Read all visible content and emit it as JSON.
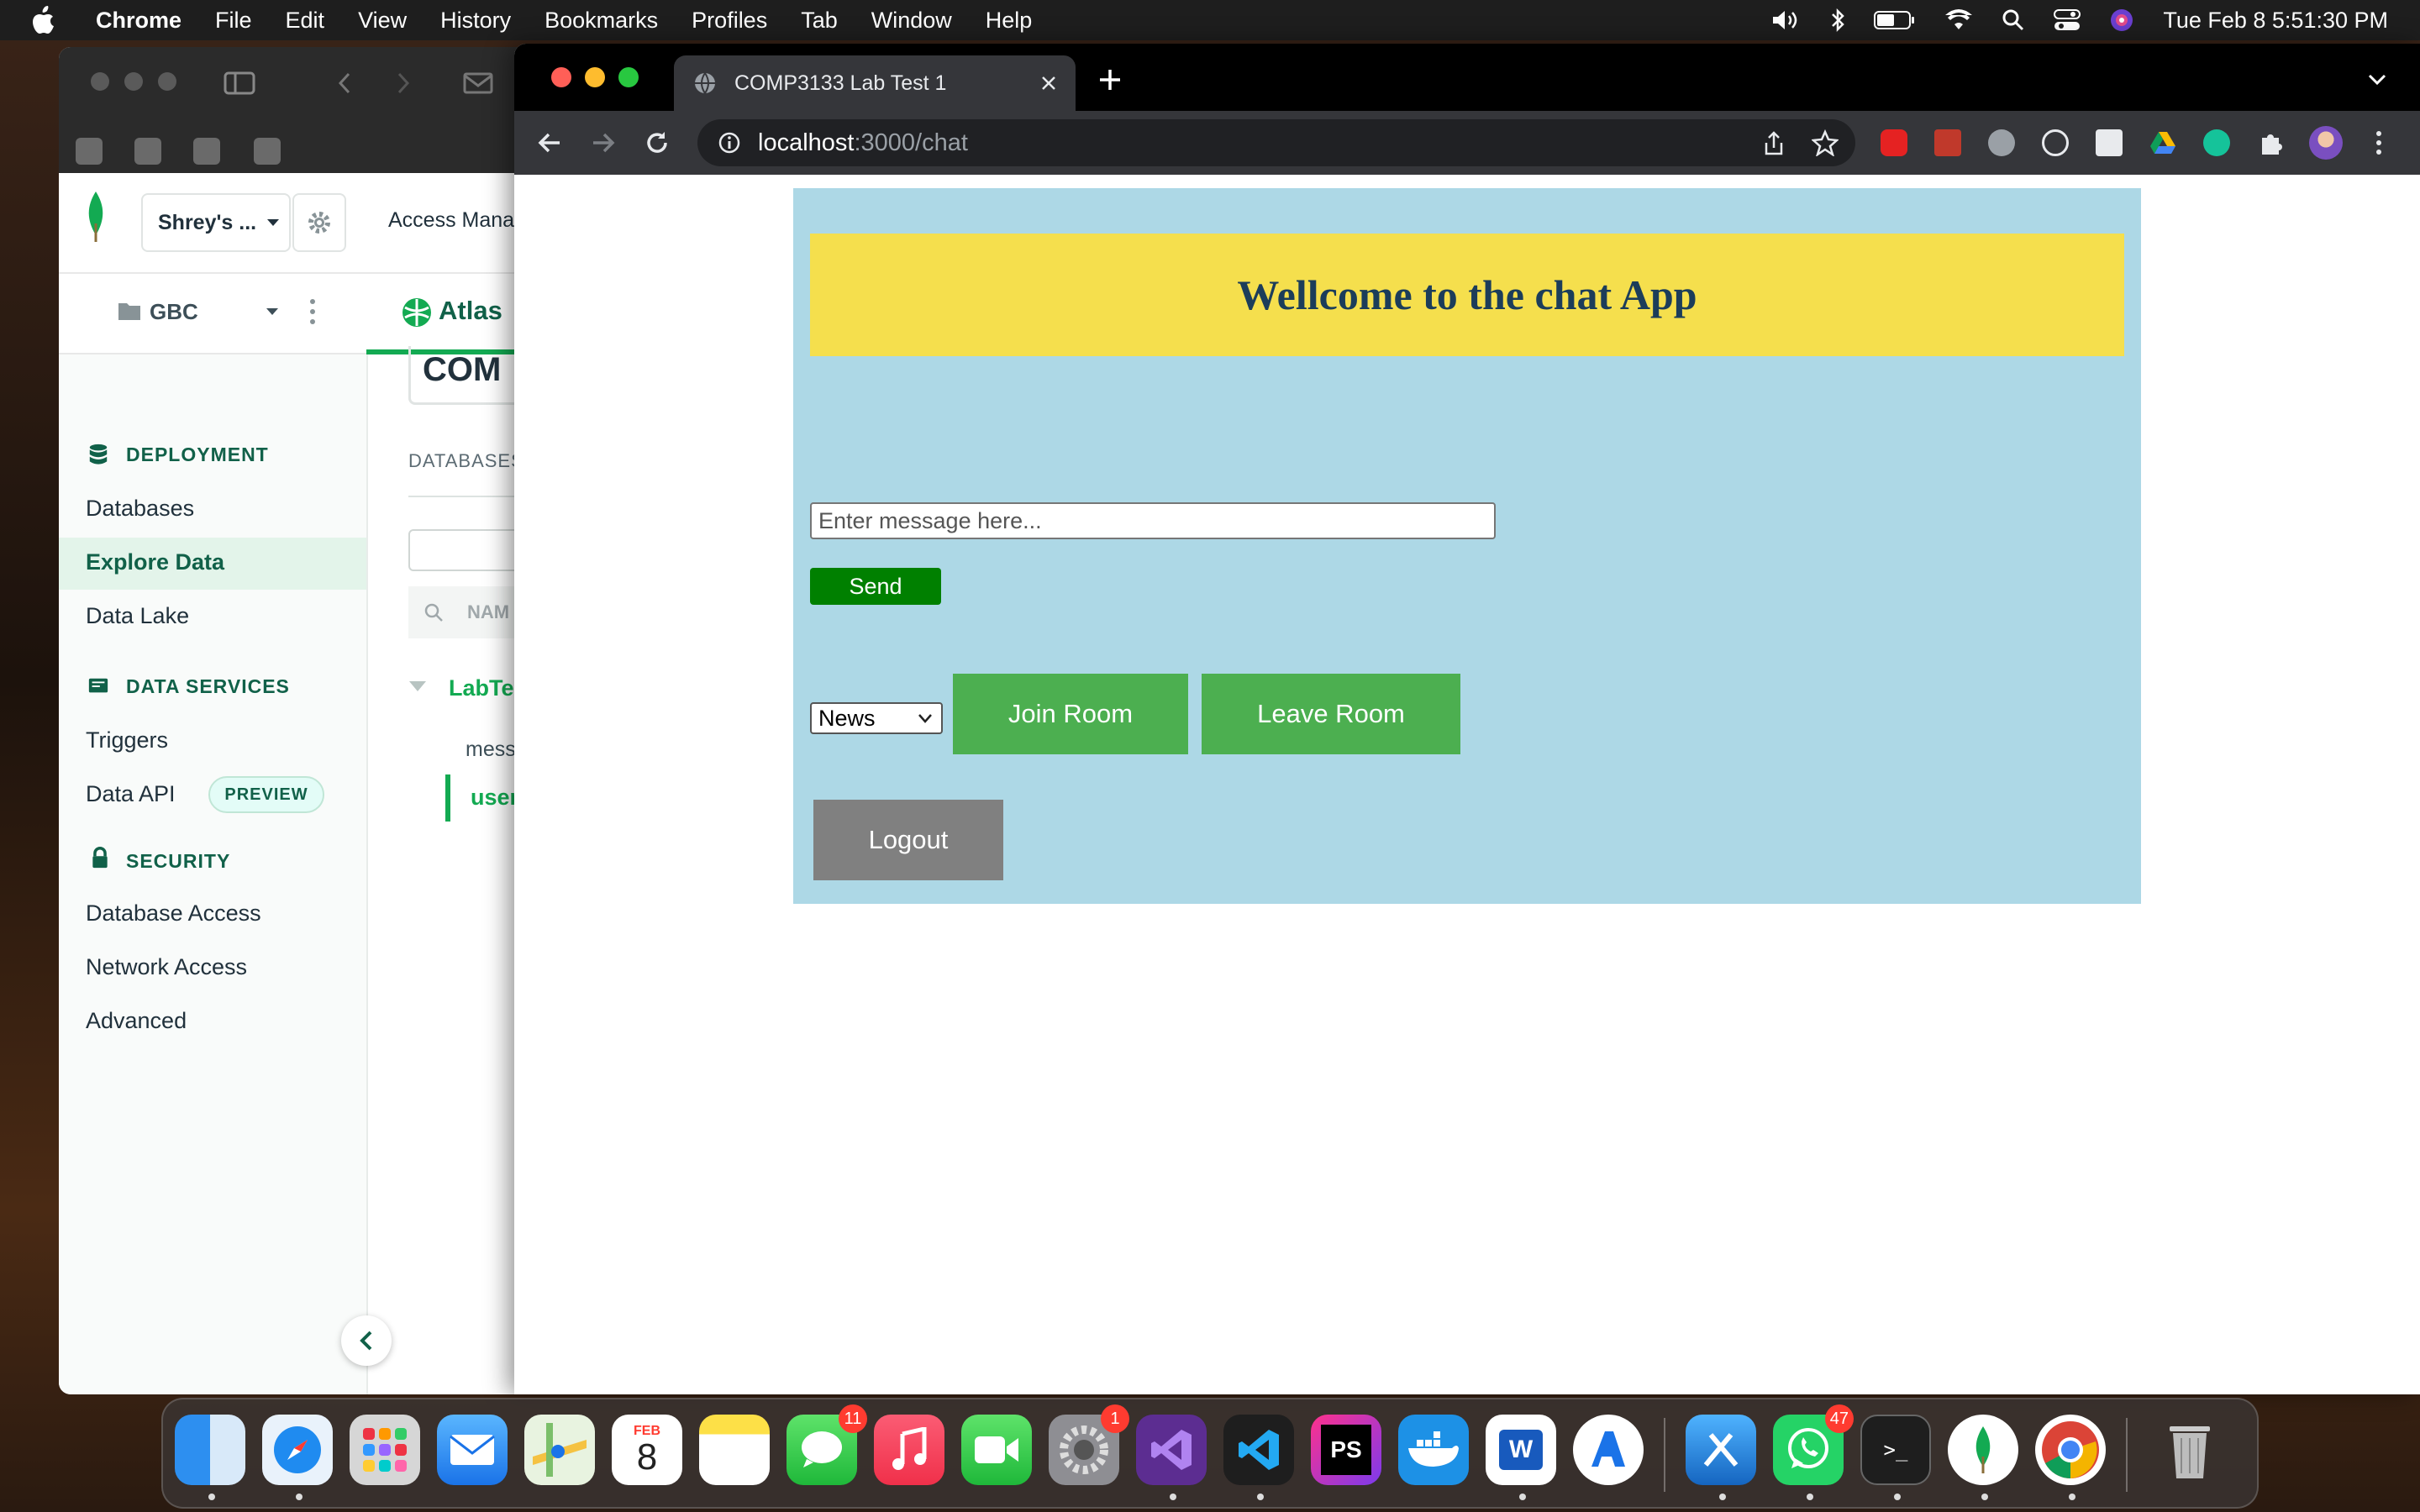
{
  "menubar": {
    "app_name": "Chrome",
    "items": [
      "File",
      "Edit",
      "View",
      "History",
      "Bookmarks",
      "Profiles",
      "Tab",
      "Window",
      "Help"
    ],
    "clock": "Tue Feb 8  5:51:30 PM"
  },
  "atlas": {
    "org_name": "Shrey's ...",
    "access_manager": "Access Mana",
    "project": "GBC",
    "atlas_tab": "Atlas",
    "cluster_heading": "COM",
    "databases_label": "DATABASES",
    "namespace_placeholder": "NAM",
    "db_name": "LabTes",
    "collection_1": "mess",
    "collection_2": "user",
    "sidebar": {
      "deployment": "DEPLOYMENT",
      "databases": "Databases",
      "explore_data": "Explore Data",
      "data_lake": "Data Lake",
      "data_services": "DATA SERVICES",
      "triggers": "Triggers",
      "data_api": "Data API",
      "preview": "PREVIEW",
      "security": "SECURITY",
      "database_access": "Database Access",
      "network_access": "Network Access",
      "advanced": "Advanced"
    }
  },
  "browser": {
    "tab_title": "COMP3133 Lab Test 1",
    "url_host": "localhost",
    "url_path": ":3000/chat"
  },
  "chat": {
    "title": "Wellcome to the chat App",
    "message_placeholder": "Enter message here...",
    "send_label": "Send",
    "room_selected": "News",
    "join_label": "Join Room",
    "leave_label": "Leave Room",
    "logout_label": "Logout"
  },
  "dock": {
    "calendar_month": "FEB",
    "calendar_day": "8",
    "messages_badge": "11",
    "settings_badge": "1",
    "whatsapp_badge": "47"
  },
  "colors": {
    "chat_bg": "#add8e6",
    "header_bg": "#f5df4d",
    "send_btn": "#008000",
    "room_btn": "#4caf50",
    "logout_btn": "#808080",
    "atlas_green": "#116149"
  }
}
